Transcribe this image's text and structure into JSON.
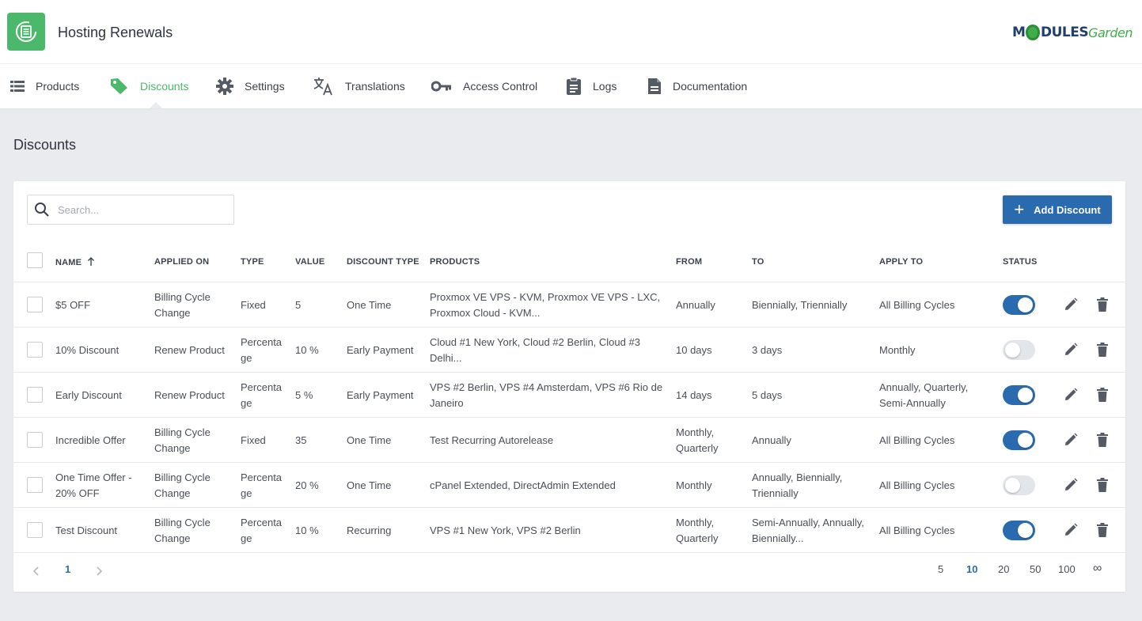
{
  "app": {
    "title": "Hosting Renewals",
    "brand_left": "M",
    "brand_mid": "DULES",
    "brand_right": "Garden"
  },
  "nav": [
    {
      "label": "Products",
      "icon": "list-icon",
      "active": false
    },
    {
      "label": "Discounts",
      "icon": "tag-icon",
      "active": true
    },
    {
      "label": "Settings",
      "icon": "gear-icon",
      "active": false
    },
    {
      "label": "Translations",
      "icon": "translate-icon",
      "active": false
    },
    {
      "label": "Access Control",
      "icon": "key-icon",
      "active": false
    },
    {
      "label": "Logs",
      "icon": "clipboard-icon",
      "active": false
    },
    {
      "label": "Documentation",
      "icon": "document-icon",
      "active": false
    }
  ],
  "page": {
    "title": "Discounts"
  },
  "search": {
    "placeholder": "Search..."
  },
  "add_button": {
    "label": "Add Discount"
  },
  "table": {
    "headers": {
      "name": "NAME",
      "applied_on": "APPLIED ON",
      "type": "TYPE",
      "value": "VALUE",
      "discount_type": "DISCOUNT TYPE",
      "products": "PRODUCTS",
      "from": "FROM",
      "to": "TO",
      "apply_to": "APPLY TO",
      "status": "STATUS"
    },
    "sort": {
      "column": "NAME",
      "direction": "asc"
    },
    "rows": [
      {
        "name": [
          "$5 OFF"
        ],
        "applied_on": [
          "Billing Cycle",
          "Change"
        ],
        "type": [
          "Fixed"
        ],
        "value": "5",
        "discount_type": "One Time",
        "products": [
          "Proxmox VE VPS - KVM, Proxmox VE VPS - LXC,",
          "Proxmox Cloud - KVM..."
        ],
        "from": [
          "Annually"
        ],
        "to": [
          "Biennially, Triennially"
        ],
        "apply_to": [
          "All Billing Cycles"
        ],
        "status": true
      },
      {
        "name": [
          "10% Discount"
        ],
        "applied_on": [
          "Renew Product"
        ],
        "type": [
          "Percenta",
          "ge"
        ],
        "value": "10 %",
        "discount_type": "Early Payment",
        "products": [
          "Cloud #1 New York, Cloud #2 Berlin, Cloud #3",
          "Delhi..."
        ],
        "from": [
          "10 days"
        ],
        "to": [
          "3 days"
        ],
        "apply_to": [
          "Monthly"
        ],
        "status": false
      },
      {
        "name": [
          "Early Discount"
        ],
        "applied_on": [
          "Renew Product"
        ],
        "type": [
          "Percenta",
          "ge"
        ],
        "value": "5 %",
        "discount_type": "Early Payment",
        "products": [
          "VPS #2 Berlin, VPS #4 Amsterdam, VPS #6 Rio de",
          "Janeiro"
        ],
        "from": [
          "14 days"
        ],
        "to": [
          "5 days"
        ],
        "apply_to": [
          "Annually, Quarterly,",
          "Semi-Annually"
        ],
        "status": true
      },
      {
        "name": [
          "Incredible Offer"
        ],
        "applied_on": [
          "Billing Cycle",
          "Change"
        ],
        "type": [
          "Fixed"
        ],
        "value": "35",
        "discount_type": "One Time",
        "products": [
          "Test Recurring Autorelease"
        ],
        "from": [
          "Monthly,",
          "Quarterly"
        ],
        "to": [
          "Annually"
        ],
        "apply_to": [
          "All Billing Cycles"
        ],
        "status": true
      },
      {
        "name": [
          "One Time Offer -",
          "20% OFF"
        ],
        "applied_on": [
          "Billing Cycle",
          "Change"
        ],
        "type": [
          "Percenta",
          "ge"
        ],
        "value": "20 %",
        "discount_type": "One Time",
        "products": [
          "cPanel Extended, DirectAdmin Extended"
        ],
        "from": [
          "Monthly"
        ],
        "to": [
          "Annually, Biennially,",
          "Triennially"
        ],
        "apply_to": [
          "All Billing Cycles"
        ],
        "status": false
      },
      {
        "name": [
          "Test Discount"
        ],
        "applied_on": [
          "Billing Cycle",
          "Change"
        ],
        "type": [
          "Percenta",
          "ge"
        ],
        "value": "10 %",
        "discount_type": "Recurring",
        "products": [
          "VPS #1 New York, VPS #2 Berlin"
        ],
        "from": [
          "Monthly,",
          "Quarterly"
        ],
        "to": [
          "Semi-Annually, Annually,",
          "Biennially..."
        ],
        "apply_to": [
          "All Billing Cycles"
        ],
        "status": true
      }
    ]
  },
  "pagination": {
    "current_page": "1",
    "page_sizes": [
      "5",
      "10",
      "20",
      "50",
      "100",
      "∞"
    ],
    "selected_page_size": "10"
  },
  "colors": {
    "accent_green": "#4cb86c",
    "primary_blue": "#2a6bb0",
    "background": "#e9ebef"
  }
}
